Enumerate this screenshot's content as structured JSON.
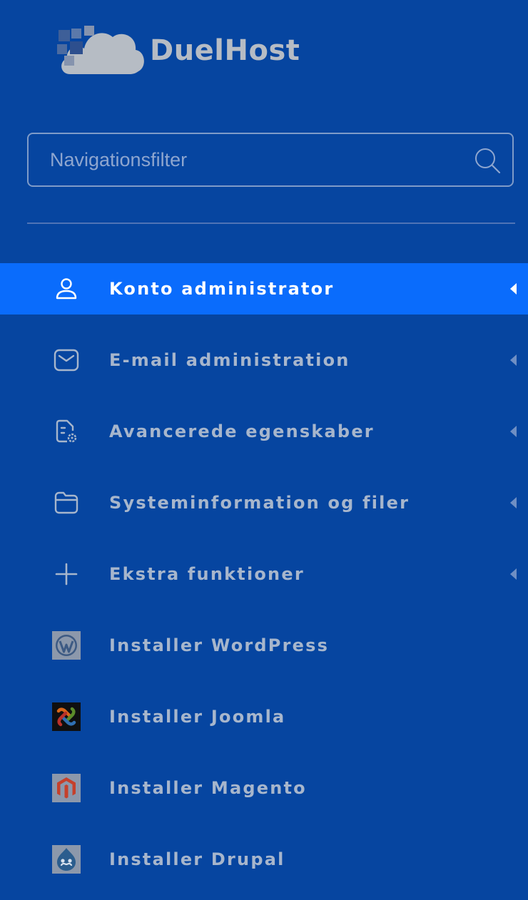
{
  "brand": {
    "name": "DuelHost",
    "logo_icon": "cloud-logo-icon"
  },
  "search": {
    "placeholder": "Navigationsfilter",
    "value": "",
    "icon": "search-icon"
  },
  "menu": {
    "items": [
      {
        "label": "Konto administrator",
        "icon": "user-icon",
        "active": true,
        "has_submenu": true
      },
      {
        "label": "E-mail administration",
        "icon": "envelope-icon",
        "active": false,
        "has_submenu": true
      },
      {
        "label": "Avancerede egenskaber",
        "icon": "document-settings-icon",
        "active": false,
        "has_submenu": true
      },
      {
        "label": "Systeminformation og filer",
        "icon": "folder-icon",
        "active": false,
        "has_submenu": true
      },
      {
        "label": "Ekstra funktioner",
        "icon": "plus-icon",
        "active": false,
        "has_submenu": true
      },
      {
        "label": "Installer WordPress",
        "icon": "wordpress-icon",
        "active": false,
        "has_submenu": false
      },
      {
        "label": "Installer Joomla",
        "icon": "joomla-icon",
        "active": false,
        "has_submenu": false
      },
      {
        "label": "Installer Magento",
        "icon": "magento-icon",
        "active": false,
        "has_submenu": false
      },
      {
        "label": "Installer Drupal",
        "icon": "drupal-icon",
        "active": false,
        "has_submenu": false
      }
    ]
  },
  "colors": {
    "background": "#0645a0",
    "active_item": "#0a6cfc",
    "label_text": "#a7b6cc",
    "active_label_text": "#ffffff"
  }
}
